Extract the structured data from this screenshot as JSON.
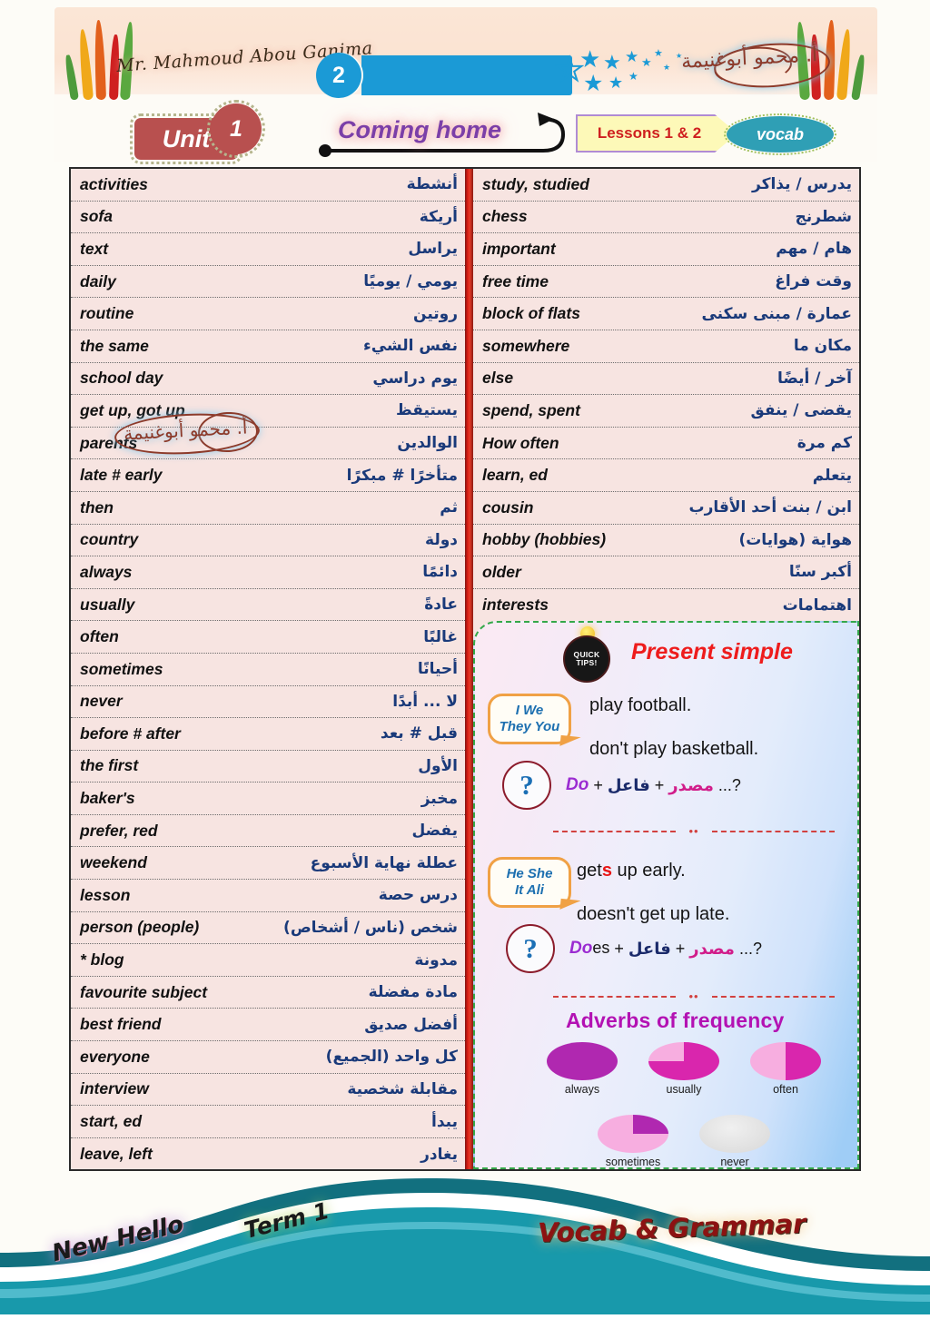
{
  "header": {
    "teacher_signature": "Mr. Mahmoud Abou Ganima",
    "stamp_arabic": "أ. محمو أبوغنيمة",
    "banner_number": "2",
    "unit_label": "Unit",
    "unit_number": "1",
    "lesson_title": "Coming home",
    "lessons_label": "Lessons 1 & 2",
    "vocab_label": "vocab"
  },
  "vocab": {
    "left_column": [
      {
        "en": "activities",
        "ar": "أنشطة"
      },
      {
        "en": "sofa",
        "ar": "أريكة"
      },
      {
        "en": "text",
        "ar": "يراسل"
      },
      {
        "en": "daily",
        "ar": "يومي / يوميًا"
      },
      {
        "en": "routine",
        "ar": "روتين"
      },
      {
        "en": "the same",
        "ar": "نفس الشيء"
      },
      {
        "en": "school day",
        "ar": "يوم دراسي"
      },
      {
        "en": "get up, got up",
        "ar": "يستيقظ"
      },
      {
        "en": "parents",
        "ar": "الوالدين"
      },
      {
        "en": "late # early",
        "ar": "متأخرًا # مبكرًا"
      },
      {
        "en": "then",
        "ar": "ثم"
      },
      {
        "en": "country",
        "ar": "دولة"
      },
      {
        "en": "always",
        "ar": "دائمًا"
      },
      {
        "en": "usually",
        "ar": "عادةً"
      },
      {
        "en": "often",
        "ar": "غالبًا"
      },
      {
        "en": "sometimes",
        "ar": "أحيانًا"
      },
      {
        "en": "never",
        "ar": "لا ... أبدًا"
      },
      {
        "en": "before # after",
        "ar": "قبل # بعد"
      },
      {
        "en": "the first",
        "ar": "الأول"
      },
      {
        "en": "baker's",
        "ar": "مخبز"
      },
      {
        "en": "prefer, red",
        "ar": "يفضل"
      },
      {
        "en": "weekend",
        "ar": "عطلة نهاية الأسبوع"
      },
      {
        "en": "lesson",
        "ar": "درس حصة"
      },
      {
        "en": "person (people)",
        "ar": "شخص (ناس / أشخاص)"
      },
      {
        "en": "* blog",
        "ar": "مدونة"
      },
      {
        "en": "favourite subject",
        "ar": "مادة مفضلة"
      },
      {
        "en": "best friend",
        "ar": "أفضل صديق"
      },
      {
        "en": "everyone",
        "ar": "كل واحد (الجميع)"
      },
      {
        "en": "interview",
        "ar": "مقابلة شخصية"
      },
      {
        "en": "start, ed",
        "ar": "يبدأ"
      },
      {
        "en": "leave, left",
        "ar": "يغادر"
      }
    ],
    "right_column": [
      {
        "en": "study, studied",
        "ar": "يدرس / يذاكر"
      },
      {
        "en": "chess",
        "ar": "شطرنج"
      },
      {
        "en": "important",
        "ar": "هام / مهم"
      },
      {
        "en": "free time",
        "ar": "وقت فراغ"
      },
      {
        "en": "block of flats",
        "ar": "عمارة / مبنى سكنى"
      },
      {
        "en": "somewhere",
        "ar": "مكان ما"
      },
      {
        "en": "else",
        "ar": "آخر / أيضًا"
      },
      {
        "en": "spend, spent",
        "ar": "يقضى / ينفق"
      },
      {
        "en": "How often",
        "ar": "كم مرة"
      },
      {
        "en": "learn, ed",
        "ar": "يتعلم"
      },
      {
        "en": "cousin",
        "ar": "ابن / بنت أحد الأقارب"
      },
      {
        "en": "hobby (hobbies)",
        "ar": "هواية (هوايات)"
      },
      {
        "en": "older",
        "ar": "أكبر سنًا"
      },
      {
        "en": "interests",
        "ar": "اهتمامات"
      }
    ]
  },
  "grammar": {
    "badge_line1": "QUICK",
    "badge_line2": "TIPS!",
    "title": "Present simple",
    "subjects_plural_line1": "I  We",
    "subjects_plural_line2": "They You",
    "affirmative_plural": "play football.",
    "negative_plural": "don't play basketball.",
    "question_plural_aux": "Do",
    "question_plural_plus1": "+",
    "question_plural_subject": "فاعل",
    "question_plural_plus2": "+",
    "question_plural_verb": "مصدر",
    "question_plural_tail": "...?",
    "subjects_singular_line1": "He She",
    "subjects_singular_line2": "It Ali",
    "affirmative_singular_stem": "get",
    "affirmative_singular_s": "s",
    "affirmative_singular_rest": " up early.",
    "negative_singular": "doesn't get up late.",
    "question_singular_aux": "Do",
    "question_singular_aux_es": "es",
    "adverbs_title": "Adverbs of frequency"
  },
  "chart_data": {
    "type": "pie",
    "title": "Adverbs of frequency",
    "categories": [
      "always",
      "usually",
      "often",
      "sometimes",
      "never"
    ],
    "values": [
      100,
      75,
      50,
      25,
      0
    ],
    "unit": "percent",
    "colors": {
      "filled": "#b028b0",
      "filled_alt": "#d926ad",
      "empty": "#f7aee0",
      "none": "#d8d8d8"
    }
  },
  "footer": {
    "book": "New Hello",
    "term": "Term 1",
    "section": "Vocab & Grammar"
  }
}
